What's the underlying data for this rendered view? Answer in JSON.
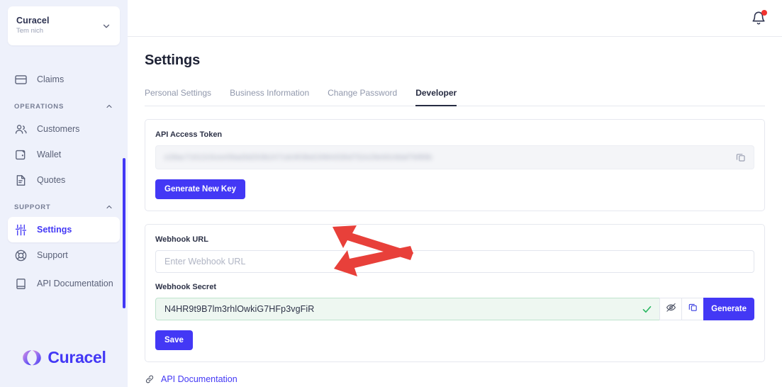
{
  "sidebar": {
    "org": {
      "name": "Curacel",
      "subtitle": "Tem nich",
      "chevron_icon": "chevron-down-icon"
    },
    "items": [
      {
        "label": "Claims",
        "icon": "claims-card-icon",
        "active": false
      },
      {
        "label": "Customers",
        "icon": "customers-icon",
        "active": false
      },
      {
        "label": "Wallet",
        "icon": "wallet-icon",
        "active": false
      },
      {
        "label": "Quotes",
        "icon": "quotes-document-icon",
        "active": false
      },
      {
        "label": "Settings",
        "icon": "sliders-settings-icon",
        "active": true
      },
      {
        "label": "Support",
        "icon": "lifebuoy-support-icon",
        "active": false
      },
      {
        "label": "API Documentation",
        "icon": "book-icon",
        "active": false
      }
    ],
    "sections": {
      "operations": "OPERATIONS",
      "support": "SUPPORT"
    },
    "brand": {
      "word": "Curacel",
      "mark_icon": "curacel-logo-icon"
    }
  },
  "topbar": {
    "bell_icon": "notification-bell-icon",
    "has_unread": true
  },
  "page": {
    "title": "Settings"
  },
  "tabs": [
    {
      "label": "Personal Settings",
      "active": false
    },
    {
      "label": "Business Information",
      "active": false
    },
    {
      "label": "Change Password",
      "active": false
    },
    {
      "label": "Developer",
      "active": true
    }
  ],
  "api_token_card": {
    "label": "API Access Token",
    "value": "e28ac71612c5cee59ad3d263b2471dc903bd19964335d752e29e60c9daf7bf89b",
    "masked": true,
    "copy_icon": "copy-icon",
    "generate_button": "Generate New Key"
  },
  "webhook_card": {
    "url_label": "Webhook URL",
    "url_placeholder": "Enter Webhook URL",
    "url_value": "",
    "secret_label": "Webhook Secret",
    "secret_value": "N4HR9t9B7lm3rhlOwkiG7HFp3vgFiR",
    "valid_icon": "check-icon",
    "hide_icon": "eye-off-icon",
    "copy_icon": "copy-icon",
    "generate_button": "Generate",
    "save_button": "Save"
  },
  "footer": {
    "doc_link": "API Documentation",
    "link_icon": "link-icon"
  },
  "colors": {
    "accent": "#4338f5",
    "sidebar_bg": "#eef1fb",
    "annotation_arrow": "#e8403a",
    "success": "#2bb862",
    "alert_dot": "#f0322e"
  }
}
